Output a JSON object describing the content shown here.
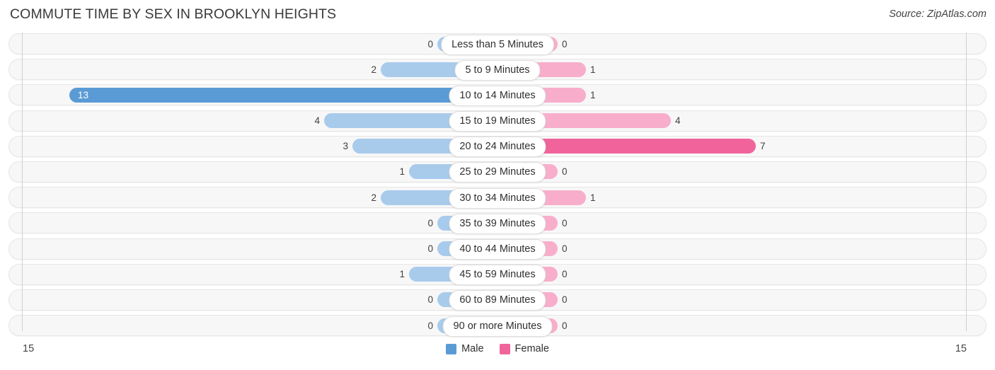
{
  "header": {
    "title": "COMMUTE TIME BY SEX IN BROOKLYN HEIGHTS",
    "source": "Source: ZipAtlas.com"
  },
  "axis": {
    "left_tick": "15",
    "right_tick": "15"
  },
  "legend": {
    "items": [
      {
        "label": "Male",
        "color": "#5b9bd5"
      },
      {
        "label": "Female",
        "color": "#f0649b"
      }
    ]
  },
  "colors": {
    "male_light": "#a8cbec",
    "male_peak": "#5b9bd5",
    "female_light": "#f8aecb",
    "female_peak": "#f0649b"
  },
  "chart_data": {
    "type": "bar",
    "orientation": "horizontal",
    "layout": "diverging-bidirectional",
    "title": "COMMUTE TIME BY SEX IN BROOKLYN HEIGHTS",
    "xlabel": "",
    "ylabel": "",
    "xlim": [
      15,
      15
    ],
    "grid": false,
    "legend_position": "bottom-center",
    "categories": [
      "Less than 5 Minutes",
      "5 to 9 Minutes",
      "10 to 14 Minutes",
      "15 to 19 Minutes",
      "20 to 24 Minutes",
      "25 to 29 Minutes",
      "30 to 34 Minutes",
      "35 to 39 Minutes",
      "40 to 44 Minutes",
      "45 to 59 Minutes",
      "60 to 89 Minutes",
      "90 or more Minutes"
    ],
    "series": [
      {
        "name": "Male",
        "values": [
          0,
          2,
          13,
          4,
          3,
          1,
          2,
          0,
          0,
          1,
          0,
          0
        ]
      },
      {
        "name": "Female",
        "values": [
          0,
          1,
          1,
          4,
          7,
          0,
          1,
          0,
          0,
          0,
          0,
          0
        ]
      }
    ]
  },
  "rows": [
    {
      "label": "Less than 5 Minutes",
      "male": "0",
      "female": "0"
    },
    {
      "label": "5 to 9 Minutes",
      "male": "2",
      "female": "1"
    },
    {
      "label": "10 to 14 Minutes",
      "male": "13",
      "female": "1"
    },
    {
      "label": "15 to 19 Minutes",
      "male": "4",
      "female": "4"
    },
    {
      "label": "20 to 24 Minutes",
      "male": "3",
      "female": "7"
    },
    {
      "label": "25 to 29 Minutes",
      "male": "1",
      "female": "0"
    },
    {
      "label": "30 to 34 Minutes",
      "male": "2",
      "female": "1"
    },
    {
      "label": "35 to 39 Minutes",
      "male": "0",
      "female": "0"
    },
    {
      "label": "40 to 44 Minutes",
      "male": "0",
      "female": "0"
    },
    {
      "label": "45 to 59 Minutes",
      "male": "1",
      "female": "0"
    },
    {
      "label": "60 to 89 Minutes",
      "male": "0",
      "female": "0"
    },
    {
      "label": "90 or more Minutes",
      "male": "0",
      "female": "0"
    }
  ]
}
